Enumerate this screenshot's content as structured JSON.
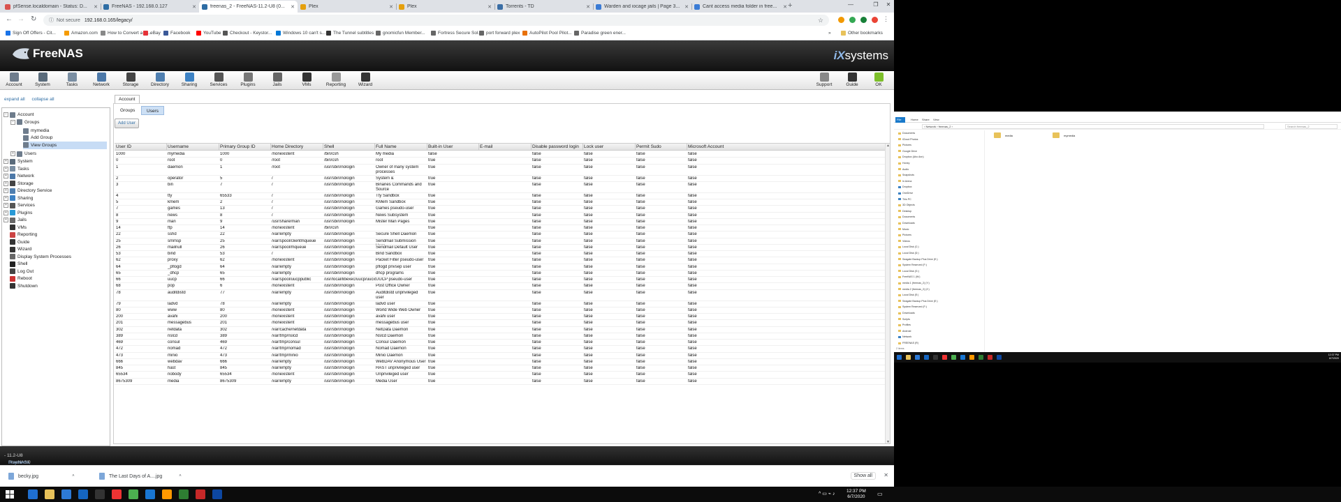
{
  "browser": {
    "tabs": [
      {
        "title": "pfSense.localdomain - Status: D...",
        "color": "#d9534f"
      },
      {
        "title": "FreeNAS - 192.168.0.127",
        "color": "#2e6da4"
      },
      {
        "title": "freenas_2 - FreeNAS-11.2-U8 (0...",
        "color": "#2e6da4",
        "active": true
      },
      {
        "title": "Plex",
        "color": "#e5a00d"
      },
      {
        "title": "Plex",
        "color": "#e5a00d"
      },
      {
        "title": "Torrents - TD",
        "color": "#3a6ea5"
      },
      {
        "title": "Warden and iocage jails | Page 3...",
        "color": "#3a7bd5"
      },
      {
        "title": "Cant access media folder in free...",
        "color": "#3a7bd5"
      }
    ],
    "new_tab": "+",
    "window_controls": {
      "minimize": "—",
      "maximize": "❐",
      "close": "✕"
    },
    "nav": {
      "back": "←",
      "forward": "→",
      "reload": "↻"
    },
    "address": {
      "security": "Not secure",
      "url": "192.168.0.165/legacy/"
    },
    "bookmarks": [
      {
        "label": "Sign Off Offers - Cit...",
        "color": "#1a73e8"
      },
      {
        "label": "Amazon.com",
        "color": "#f59b00"
      },
      {
        "label": "How to Convert a S...",
        "color": "#888"
      },
      {
        "label": "eBay",
        "color": "#e53238"
      },
      {
        "label": "Facebook",
        "color": "#3b5998"
      },
      {
        "label": "YouTube",
        "color": "#ff0000"
      },
      {
        "label": "Checkout - Keystor...",
        "color": "#555"
      },
      {
        "label": "Windows 10 can't s...",
        "color": "#0078d7"
      },
      {
        "label": "The Tunnel subtitles",
        "color": "#333"
      },
      {
        "label": "gnomicfun Member...",
        "color": "#666"
      },
      {
        "label": "Fortress Secure Sol...",
        "color": "#666"
      },
      {
        "label": "port forward plex",
        "color": "#666"
      },
      {
        "label": "AutoPilot Pool Pilot...",
        "color": "#e8710a"
      },
      {
        "label": "Paradise green ener...",
        "color": "#666"
      }
    ],
    "bookmarks_more": "»",
    "other_bookmarks": "Other bookmarks"
  },
  "freenas": {
    "brand": "FreeNAS",
    "vendor_prefix": "iX",
    "vendor_suffix": "systems",
    "toolbar": [
      {
        "label": "Account",
        "color": "#6e7c8c"
      },
      {
        "label": "System",
        "color": "#5a6b7b"
      },
      {
        "label": "Tasks",
        "color": "#7a8ea2"
      },
      {
        "label": "Network",
        "color": "#4c78a8"
      },
      {
        "label": "Storage",
        "color": "#444"
      },
      {
        "label": "Directory",
        "color": "#4f7fb0"
      },
      {
        "label": "Sharing",
        "color": "#3d82c4"
      },
      {
        "label": "Services",
        "color": "#555"
      },
      {
        "label": "Plugins",
        "color": "#777"
      },
      {
        "label": "Jails",
        "color": "#666"
      },
      {
        "label": "VMs",
        "color": "#333"
      },
      {
        "label": "Reporting",
        "color": "#999"
      },
      {
        "label": "Wizard",
        "color": "#333"
      }
    ],
    "toolbar_right": [
      {
        "label": "Support",
        "color": "#888"
      },
      {
        "label": "Guide",
        "color": "#333"
      },
      {
        "label": "OK",
        "color": "#7dbf2a"
      }
    ],
    "tree_links": {
      "expand": "expand all",
      "collapse": "collapse all"
    },
    "tree": [
      {
        "label": "Account",
        "level": 0,
        "toggle": "−",
        "color": "#6e7c8c"
      },
      {
        "label": "Groups",
        "level": 1,
        "toggle": "−",
        "color": "#6e7c8c"
      },
      {
        "label": "mymedia",
        "level": 2,
        "color": "#6e7c8c"
      },
      {
        "label": "Add Group",
        "level": 2,
        "color": "#6e7c8c"
      },
      {
        "label": "View Groups",
        "level": 2,
        "color": "#6e7c8c",
        "selected": true
      },
      {
        "label": "Users",
        "level": 1,
        "toggle": "+",
        "color": "#6e7c8c"
      },
      {
        "label": "System",
        "level": 0,
        "toggle": "+",
        "color": "#5a6b7b"
      },
      {
        "label": "Tasks",
        "level": 0,
        "toggle": "+",
        "color": "#7a8ea2"
      },
      {
        "label": "Network",
        "level": 0,
        "toggle": "+",
        "color": "#4c78a8"
      },
      {
        "label": "Storage",
        "level": 0,
        "toggle": "+",
        "color": "#444"
      },
      {
        "label": "Directory Service",
        "level": 0,
        "toggle": "+",
        "color": "#4f7fb0"
      },
      {
        "label": "Sharing",
        "level": 0,
        "toggle": "+",
        "color": "#3d82c4"
      },
      {
        "label": "Services",
        "level": 0,
        "toggle": "+",
        "color": "#555"
      },
      {
        "label": "Plugins",
        "level": 0,
        "toggle": "+",
        "color": "#2a9ad6"
      },
      {
        "label": "Jails",
        "level": 0,
        "toggle": "+",
        "color": "#666"
      },
      {
        "label": "VMs",
        "level": 0,
        "color": "#333"
      },
      {
        "label": "Reporting",
        "level": 0,
        "color": "#c44"
      },
      {
        "label": "Guide",
        "level": 0,
        "color": "#333"
      },
      {
        "label": "Wizard",
        "level": 0,
        "color": "#333"
      },
      {
        "label": "Display System Processes",
        "level": 0,
        "color": "#666"
      },
      {
        "label": "Shell",
        "level": 0,
        "color": "#222"
      },
      {
        "label": "Log Out",
        "level": 0,
        "color": "#444"
      },
      {
        "label": "Reboot",
        "level": 0,
        "color": "#c33"
      },
      {
        "label": "Shutdown",
        "level": 0,
        "color": "#333"
      }
    ],
    "content_tab": "Account",
    "subtabs": {
      "groups": "Groups",
      "users": "Users"
    },
    "add_user": "Add User",
    "columns": [
      "User ID",
      "Username",
      "Primary Group ID",
      "Home Directory",
      "Shell",
      "Full Name",
      "Built-in User",
      "E-mail",
      "Disable password login",
      "Lock user",
      "Permit Sudo",
      "Microsoft Account"
    ],
    "rows": [
      [
        "1000",
        "mymedia",
        "1000",
        "/nonexistent",
        "/bin/csh",
        "My media",
        "false",
        "",
        "false",
        "false",
        "false",
        "false"
      ],
      [
        "0",
        "root",
        "0",
        "/root",
        "/bin/csh",
        "root",
        "true",
        "",
        "false",
        "false",
        "false",
        "false"
      ],
      [
        "1",
        "daemon",
        "1",
        "/root",
        "/usr/sbin/nologin",
        "Owner of many system processes",
        "true",
        "",
        "false",
        "false",
        "false",
        "false"
      ],
      [
        "2",
        "operator",
        "5",
        "/",
        "/usr/sbin/nologin",
        "System &",
        "true",
        "",
        "false",
        "false",
        "false",
        "false"
      ],
      [
        "3",
        "bin",
        "7",
        "/",
        "/usr/sbin/nologin",
        "Binaries Commands and Source",
        "true",
        "",
        "false",
        "false",
        "false",
        "false"
      ],
      [
        "4",
        "tty",
        "65533",
        "/",
        "/usr/sbin/nologin",
        "Tty Sandbox",
        "true",
        "",
        "false",
        "false",
        "false",
        "false"
      ],
      [
        "5",
        "kmem",
        "2",
        "/",
        "/usr/sbin/nologin",
        "KMem Sandbox",
        "true",
        "",
        "false",
        "false",
        "false",
        "false"
      ],
      [
        "7",
        "games",
        "13",
        "/",
        "/usr/sbin/nologin",
        "Games pseudo-user",
        "true",
        "",
        "false",
        "false",
        "false",
        "false"
      ],
      [
        "8",
        "news",
        "8",
        "/",
        "/usr/sbin/nologin",
        "News Subsystem",
        "true",
        "",
        "false",
        "false",
        "false",
        "false"
      ],
      [
        "9",
        "man",
        "9",
        "/usr/share/man",
        "/usr/sbin/nologin",
        "Mister Man Pages",
        "true",
        "",
        "false",
        "false",
        "false",
        "false"
      ],
      [
        "14",
        "ftp",
        "14",
        "/nonexistent",
        "/bin/csh",
        "",
        "true",
        "",
        "false",
        "false",
        "false",
        "false"
      ],
      [
        "22",
        "sshd",
        "22",
        "/var/empty",
        "/usr/sbin/nologin",
        "Secure Shell Daemon",
        "true",
        "",
        "false",
        "false",
        "false",
        "false"
      ],
      [
        "25",
        "smmsp",
        "25",
        "/var/spool/clientmqueue",
        "/usr/sbin/nologin",
        "Sendmail Submission User",
        "true",
        "",
        "false",
        "false",
        "false",
        "false"
      ],
      [
        "26",
        "mailnull",
        "26",
        "/var/spool/mqueue",
        "/usr/sbin/nologin",
        "Sendmail Default User",
        "true",
        "",
        "false",
        "false",
        "false",
        "false"
      ],
      [
        "53",
        "bind",
        "53",
        "/",
        "/usr/sbin/nologin",
        "Bind Sandbox",
        "true",
        "",
        "false",
        "false",
        "false",
        "false"
      ],
      [
        "62",
        "proxy",
        "62",
        "/nonexistent",
        "/usr/sbin/nologin",
        "Packet Filter pseudo-user",
        "true",
        "",
        "false",
        "false",
        "false",
        "false"
      ],
      [
        "64",
        "_pflogd",
        "64",
        "/var/empty",
        "/usr/sbin/nologin",
        "pflogd privsep user",
        "true",
        "",
        "false",
        "false",
        "false",
        "false"
      ],
      [
        "65",
        "_dhcp",
        "65",
        "/var/empty",
        "/usr/sbin/nologin",
        "dhcp programs",
        "true",
        "",
        "false",
        "false",
        "false",
        "false"
      ],
      [
        "66",
        "uucp",
        "66",
        "/var/spool/uucppublic",
        "/usr/local/libexec/uucp/uucico",
        "UUCP pseudo-user",
        "true",
        "",
        "false",
        "false",
        "false",
        "false"
      ],
      [
        "68",
        "pop",
        "6",
        "/nonexistent",
        "/usr/sbin/nologin",
        "Post Office Owner",
        "true",
        "",
        "false",
        "false",
        "false",
        "false"
      ],
      [
        "78",
        "auditdistd",
        "77",
        "/var/empty",
        "/usr/sbin/nologin",
        "Auditdistd unprivileged user",
        "true",
        "",
        "false",
        "false",
        "false",
        "false"
      ],
      [
        "79",
        "ladvd",
        "78",
        "/var/empty",
        "/usr/sbin/nologin",
        "ladvd user",
        "true",
        "",
        "false",
        "false",
        "false",
        "false"
      ],
      [
        "80",
        "www",
        "80",
        "/nonexistent",
        "/usr/sbin/nologin",
        "World Wide Web Owner",
        "true",
        "",
        "false",
        "false",
        "false",
        "false"
      ],
      [
        "200",
        "avahi",
        "200",
        "/nonexistent",
        "/usr/sbin/nologin",
        "avahi user",
        "true",
        "",
        "false",
        "false",
        "false",
        "false"
      ],
      [
        "201",
        "messagebus",
        "201",
        "/nonexistent",
        "/usr/sbin/nologin",
        "messagebus user",
        "true",
        "",
        "false",
        "false",
        "false",
        "false"
      ],
      [
        "302",
        "netdata",
        "302",
        "/var/cache/netdata",
        "/usr/sbin/nologin",
        "NetData Daemon",
        "true",
        "",
        "false",
        "false",
        "false",
        "false"
      ],
      [
        "389",
        "nslcd",
        "389",
        "/var/tmp/nslcd",
        "/usr/sbin/nologin",
        "Nslcd Daemon",
        "true",
        "",
        "false",
        "false",
        "false",
        "false"
      ],
      [
        "469",
        "consul",
        "469",
        "/var/tmp/consul",
        "/usr/sbin/nologin",
        "Consul Daemon",
        "true",
        "",
        "false",
        "false",
        "false",
        "false"
      ],
      [
        "472",
        "nomad",
        "472",
        "/var/tmp/nomad",
        "/usr/sbin/nologin",
        "Nomad Daemon",
        "true",
        "",
        "false",
        "false",
        "false",
        "false"
      ],
      [
        "473",
        "minio",
        "473",
        "/var/tmp/minio",
        "/usr/sbin/nologin",
        "Minio Daemon",
        "true",
        "",
        "false",
        "false",
        "false",
        "false"
      ],
      [
        "666",
        "webdav",
        "666",
        "/var/empty",
        "/usr/sbin/nologin",
        "WebDAV Anonymous User",
        "true",
        "",
        "false",
        "false",
        "false",
        "false"
      ],
      [
        "845",
        "hast",
        "845",
        "/var/empty",
        "/usr/sbin/nologin",
        "HAST unprivileged user",
        "true",
        "",
        "false",
        "false",
        "false",
        "false"
      ],
      [
        "65534",
        "nobody",
        "65534",
        "/nonexistent",
        "/usr/sbin/nologin",
        "Unprivileged user",
        "true",
        "",
        "false",
        "false",
        "false",
        "false"
      ],
      [
        "8675309",
        "media",
        "8675309",
        "/var/empty",
        "/usr/sbin/nologin",
        "Media User",
        "true",
        "",
        "false",
        "false",
        "false",
        "false"
      ]
    ],
    "footer": {
      "copyright": "FreeNAS® © 2020 - ",
      "vendor": "iXsystems, Inc.",
      "version": " - 11.2-U8"
    }
  },
  "downloads": {
    "items": [
      {
        "name": "becky.jpg"
      },
      {
        "name": "The Last Days of A....jpg"
      }
    ],
    "show_all": "Show all",
    "close": "✕"
  },
  "taskbar": {
    "time": "12:37 PM",
    "date": "6/7/2020",
    "tray": "^ ▭ ⌁ ♪",
    "icons": [
      "#1f6fd0",
      "#e8c25a",
      "#2d7ad6",
      "#1565c0",
      "#333",
      "#e33",
      "#4caf50",
      "#1976d2",
      "#ff9800",
      "#2e7d32",
      "#c62828",
      "#0d47a1"
    ]
  },
  "explorer": {
    "ribbon": [
      "File",
      "Home",
      "Share",
      "View"
    ],
    "path": "› Network › freenas_2 ›",
    "search": "Search freenas_2",
    "nav_items": [
      "Documents",
      "iCloud Photos",
      "Pictures",
      "Google Drive",
      "Dropbox (Aho Ann)",
      "Honey",
      "Audio",
      "Snapshots",
      "In Arena",
      "Dropbox",
      "OneDrive",
      "This PC",
      "3D Objects",
      "Desktop",
      "Documents",
      "Downloads",
      "Music",
      "Pictures",
      "Videos",
      "Local Disk (C:)",
      "Local Disk (D:)",
      "Seagate Backup Plus Drive (E:)",
      "System Reserved (F:)",
      "Local Disk (G:)",
      "FreeNAS 1 (W:)",
      "media 1 (freenas_2) (Y:)",
      "media 2 (freenas_2) (Z:)",
      "Local Disk (E:)",
      "Seagate Backup Plus Drive (E:)",
      "System Reserved (F:)",
      "Downloads",
      "Scripts",
      "Profiles",
      "Android",
      "Network",
      "FREENAS (R)"
    ],
    "files": [
      "media",
      "mymedia"
    ],
    "status": "2 items",
    "time": "12:37 PM",
    "date": "6/7/2020"
  }
}
